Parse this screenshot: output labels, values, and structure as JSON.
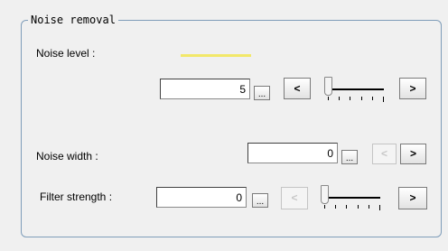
{
  "group": {
    "title": "Noise removal"
  },
  "noise_level": {
    "label": "Noise level :",
    "value": "5",
    "ellipsis": "...",
    "dec_label": "<",
    "inc_label": ">",
    "slider_fraction": 0.0,
    "indicator_color": "#f2e86a"
  },
  "noise_width": {
    "label": "Noise width :",
    "value": "0",
    "ellipsis": "...",
    "dec_label": "<",
    "inc_label": ">"
  },
  "filter_strength": {
    "label": "Filter strength :",
    "value": "0",
    "ellipsis": "...",
    "dec_label": "<",
    "inc_label": ">",
    "slider_fraction": 0.0
  },
  "colors": {
    "panel_bg": "#f0f0f0",
    "frame": "#7f9db9",
    "disabled_text": "#c8c8c8"
  }
}
